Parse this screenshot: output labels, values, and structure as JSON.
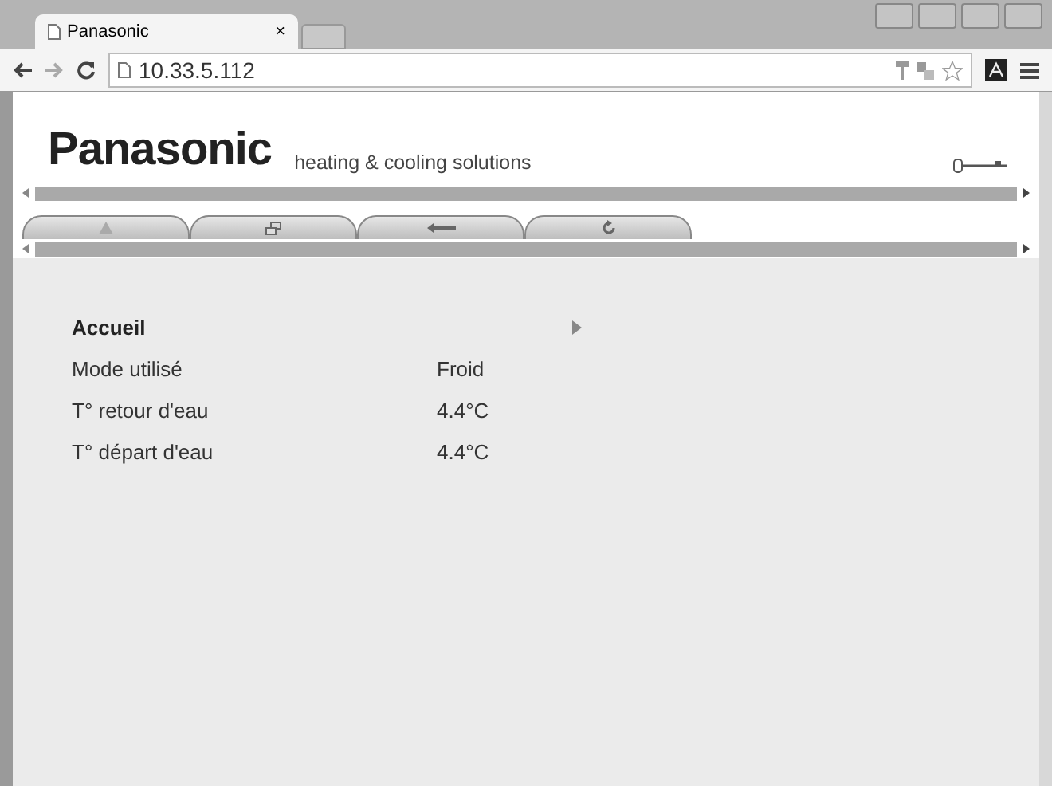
{
  "browser": {
    "tab": {
      "title": "Panasonic",
      "close": "×"
    },
    "url": "10.33.5.112"
  },
  "header": {
    "brand": "Panasonic",
    "tagline": "heating & cooling solutions"
  },
  "toolbar": [
    {
      "kind": "home"
    },
    {
      "kind": "windows"
    },
    {
      "kind": "back"
    },
    {
      "kind": "refresh"
    }
  ],
  "content": {
    "title": "Accueil",
    "rows": [
      {
        "label": "Mode utilisé",
        "value": "Froid"
      },
      {
        "label": "T° retour d'eau",
        "value": "4.4°C"
      },
      {
        "label": "T° départ d'eau",
        "value": "4.4°C"
      }
    ]
  }
}
